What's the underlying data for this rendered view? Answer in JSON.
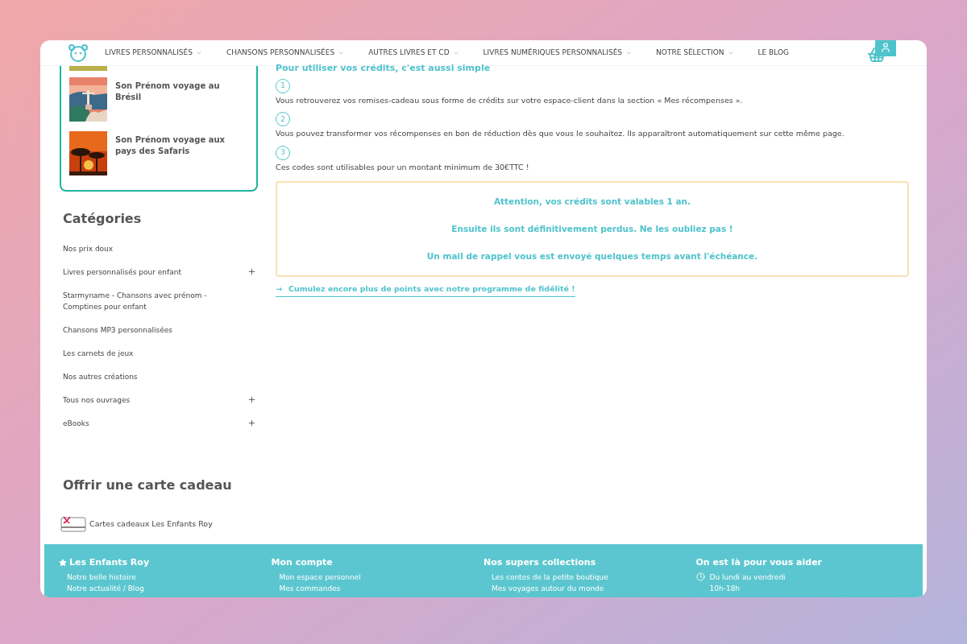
{
  "nav": {
    "items": [
      {
        "label": "LIVRES PERSONNALISÉS",
        "dropdown": true
      },
      {
        "label": "CHANSONS PERSONNALISÉES",
        "dropdown": true
      },
      {
        "label": "AUTRES LIVRES ET CD",
        "dropdown": true
      },
      {
        "label": "LIVRES NUMÉRIQUES PERSONNALISÉS",
        "dropdown": true
      },
      {
        "label": "NOTRE SÉLECTION",
        "dropdown": true
      },
      {
        "label": "LE BLOG",
        "dropdown": false
      }
    ]
  },
  "products": [
    {
      "title": "Son Prénom voyage au Brésil",
      "kind": "brazil"
    },
    {
      "title": "Son Prénom voyage aux pays des Safaris",
      "kind": "safari"
    }
  ],
  "categories": {
    "title": "Catégories",
    "items": [
      {
        "label": "Nos prix doux",
        "expandable": false
      },
      {
        "label": "Livres personnalisés pour enfant",
        "expandable": true
      },
      {
        "label": "Starmyname - Chansons avec prénom - Comptines pour enfant",
        "expandable": false
      },
      {
        "label": "Chansons MP3 personnalisées",
        "expandable": false
      },
      {
        "label": "Les carnets de jeux",
        "expandable": false
      },
      {
        "label": "Nos autres créations",
        "expandable": false
      },
      {
        "label": "Tous nos ouvrages",
        "expandable": true
      },
      {
        "label": "eBooks",
        "expandable": true
      }
    ]
  },
  "gift": {
    "title": "Offrir une carte cadeau",
    "link": "Cartes cadeaux Les Enfants Roy"
  },
  "content": {
    "heading": "Pour utiliser vos crédits, c'est aussi simple",
    "steps": [
      {
        "number": "1",
        "text": "Vous retrouverez vos remises-cadeau sous forme de crédits sur votre espace-client dans la section « Mes récompenses »."
      },
      {
        "number": "2",
        "text": "Vous pouvez transformer vos récompenses en bon de réduction dès que vous le souhaitez. Ils apparaîtront automatiquement sur cette même page."
      },
      {
        "number": "3",
        "text": "Ces codes sont utilisables pour un montant minimum de 30€TTC !"
      }
    ],
    "notice": [
      "Attention, vos crédits sont valables 1 an.",
      "Ensuite ils sont définitivement perdus. Ne les oubliez pas !",
      "Un mail de rappel vous est envoyé quelques temps avant l'échéance."
    ],
    "link_arrow": "→",
    "link": "Cumulez encore plus de points avec notre programme de fidélité !"
  },
  "footer": {
    "columns": [
      {
        "kind": "brand",
        "title": "Les Enfants Roy",
        "links": [
          "Notre belle histoire",
          "Notre actualité / Blog"
        ]
      },
      {
        "kind": "plain",
        "title": "Mon compte",
        "links": [
          "Mon espace personnel",
          "Mes commandes"
        ]
      },
      {
        "kind": "plain",
        "title": "Nos supers collections",
        "links": [
          "Les contes de la petite boutique",
          "Mes voyages autour du monde"
        ]
      },
      {
        "kind": "hours",
        "title": "On est là pour vous aider",
        "links": [
          "Du lundi au vendredi",
          "10h-18h"
        ]
      }
    ]
  }
}
